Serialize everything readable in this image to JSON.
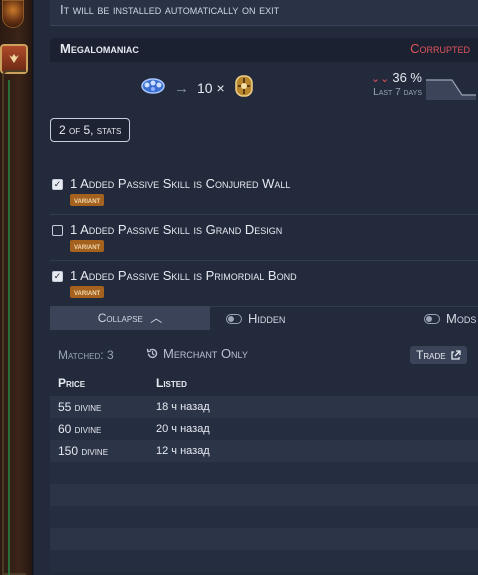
{
  "banner": {
    "text": "It will be installed automatically on exit"
  },
  "item": {
    "name": "Megalomaniac",
    "status": "Corrupted",
    "price_qty": "10 ×",
    "change_pct": "36 %",
    "change_period": "Last 7 days"
  },
  "pager": {
    "label": "2 of 5, stats"
  },
  "stats": [
    {
      "text": "1 Added Passive Skill is Conjured Wall",
      "badge": "variant",
      "checked": true
    },
    {
      "text": "1 Added Passive Skill is Grand Design",
      "badge": "variant",
      "checked": false
    },
    {
      "text": "1 Added Passive Skill is Primordial Bond",
      "badge": "variant",
      "checked": true
    }
  ],
  "controls": {
    "collapse": "Collapse",
    "hidden": "Hidden",
    "mods": "Mods"
  },
  "results": {
    "matched": "Matched: 3",
    "merchant_only": "Merchant Only",
    "trade": "Trade",
    "columns": {
      "price": "Price",
      "listed": "Listed"
    },
    "rows": [
      {
        "price": "55 divine",
        "listed": "18 ч назад"
      },
      {
        "price": "60 divine",
        "listed": "20 ч назад"
      },
      {
        "price": "150 divine",
        "listed": "12 ч назад"
      }
    ]
  },
  "colors": {
    "corrupted": "#e0545a",
    "variant_badge": "#a4621e",
    "panel": "#232a3c"
  },
  "icons": {
    "source_item": "jewel-icon",
    "arrow": "arrow-right-icon",
    "currency": "divine-orb-icon",
    "trend": "chevrons-down-icon",
    "merchant": "history-icon",
    "trade": "external-link-icon"
  }
}
